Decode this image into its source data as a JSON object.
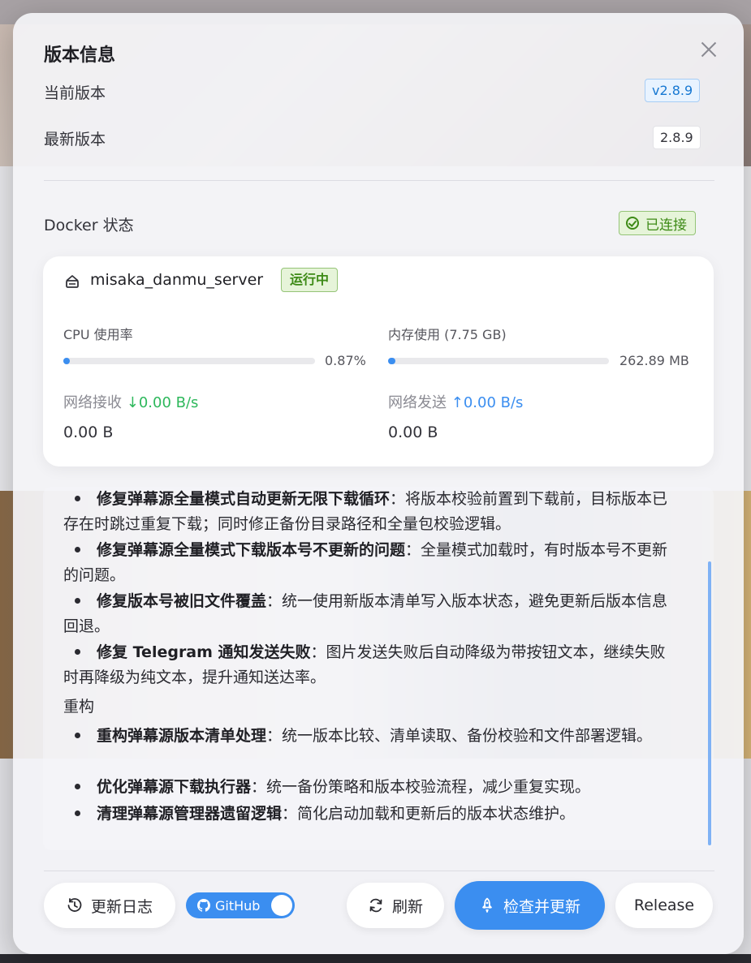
{
  "dialog": {
    "title": "版本信息",
    "current_version_label": "当前版本",
    "current_version": "v2.8.9",
    "latest_version_label": "最新版本",
    "latest_version": "2.8.9",
    "docker_status_label": "Docker 状态",
    "docker_status": "已连接",
    "close_icon": "close-icon"
  },
  "container": {
    "name": "misaka_danmu_server",
    "state": "运行中",
    "cpu_label": "CPU 使用率",
    "cpu_value": "0.87%",
    "cpu_fraction": 0.0087,
    "mem_label": "内存使用 (7.75 GB)",
    "mem_value": "262.89 MB",
    "mem_fraction": 0.033,
    "net_rx_label": "网络接收",
    "net_rx_rate": "↓0.00 B/s",
    "net_rx_total": "0.00 B",
    "net_tx_label": "网络发送",
    "net_tx_rate": "↑0.00 B/s",
    "net_tx_total": "0.00 B"
  },
  "changelog": {
    "items_fix": [
      {
        "title": "修复弹幕源全量模式自动更新无限下载循环",
        "text": "：将版本校验前置到下载前，目标版本已存在时跳过重复下载；同时修正备份目录路径和全量包校验逻辑。"
      },
      {
        "title": "修复弹幕源全量模式下载版本号不更新的问题",
        "text": "：全量模式加载时，有时版本号不更新的问题。"
      },
      {
        "title": "修复版本号被旧文件覆盖",
        "text": "：统一使用新版本清单写入版本状态，避免更新后版本信息回退。"
      },
      {
        "title": "修复 Telegram 通知发送失败",
        "text": "：图片发送失败后自动降级为带按钮文本，继续失败时再降级为纯文本，提升通知送达率。"
      }
    ],
    "section_refactor": "重构",
    "items_refactor": [
      {
        "title": "重构弹幕源版本清单处理",
        "text": "：统一版本比较、清单读取、备份校验和文件部署逻辑。"
      },
      {
        "title": "优化弹幕源下载执行器",
        "text": "：统一备份策略和版本校验流程，减少重复实现。"
      },
      {
        "title": "清理弹幕源管理器遗留逻辑",
        "text": "：简化启动加载和更新后的版本状态维护。"
      }
    ]
  },
  "footer": {
    "changelog_button": "更新日志",
    "github_toggle": "GitHub",
    "refresh_button": "刷新",
    "check_update_button": "检查并更新",
    "release_button": "Release"
  },
  "colors": {
    "accent": "#3b8ef0",
    "success": "#3d8a16"
  }
}
